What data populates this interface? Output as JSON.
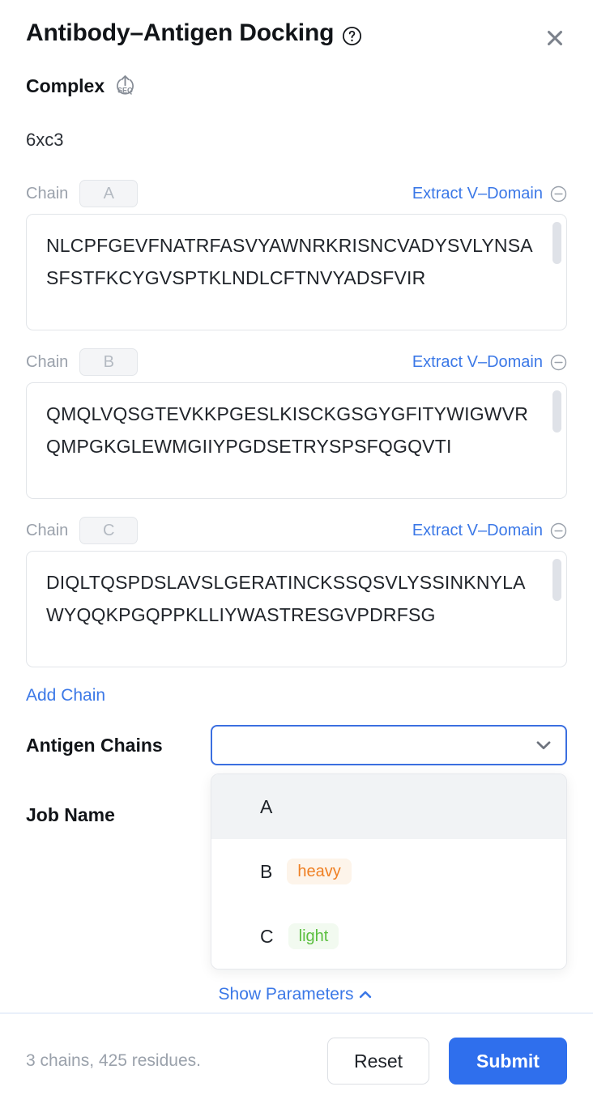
{
  "header": {
    "title": "Antibody–Antigen Docking",
    "help_icon": "question-circle-icon",
    "close_icon": "close-icon"
  },
  "complex": {
    "label": "Complex",
    "upload_icon": "upload-seq-icon",
    "id": "6xc3"
  },
  "chains": [
    {
      "chain_word": "Chain",
      "chip": "A",
      "extract_label": "Extract V–Domain",
      "remove_icon": "minus-circle-icon",
      "sequence": "NLCPFGEVFNATRFASVYAWNRKRISNCVADYSVLYNSASFSTFKCYGVSPTKLNDLCFTNVYADSFVIR"
    },
    {
      "chain_word": "Chain",
      "chip": "B",
      "extract_label": "Extract V–Domain",
      "remove_icon": "minus-circle-icon",
      "sequence": "QMQLVQSGTEVKKPGESLKISCKGSGYGFITYWIGWVRQMPGKGLEWMGIIYPGDSETRYSPSFQGQVTI"
    },
    {
      "chain_word": "Chain",
      "chip": "C",
      "extract_label": "Extract V–Domain",
      "remove_icon": "minus-circle-icon",
      "sequence": "DIQLTQSPDSLAVSLGERATINCKSSQSVLYSSINKNYLAWYQQKPGQPPKLLIYWASTRESGVPDRFSG"
    }
  ],
  "add_chain_label": "Add Chain",
  "antigen": {
    "label": "Antigen Chains",
    "value": "",
    "placeholder": "",
    "chevron_icon": "chevron-down-icon",
    "options": [
      {
        "letter": "A",
        "badge": "",
        "badge_type": "none",
        "active": true
      },
      {
        "letter": "B",
        "badge": "heavy",
        "badge_type": "heavy",
        "active": false
      },
      {
        "letter": "C",
        "badge": "light",
        "badge_type": "light",
        "active": false
      }
    ]
  },
  "job_name": {
    "label": "Job Name",
    "value": ""
  },
  "show_parameters": {
    "label": "Show Parameters",
    "chevron_icon": "chevron-up-icon"
  },
  "footer": {
    "residue_info": "3 chains, 425 residues.",
    "reset_label": "Reset",
    "submit_label": "Submit"
  },
  "colors": {
    "accent_blue": "#2f6fed",
    "link_blue": "#3b78e7",
    "heavy_orange": "#ef8024",
    "light_green": "#5bbf3f",
    "muted_gray": "#9aa1ab"
  }
}
